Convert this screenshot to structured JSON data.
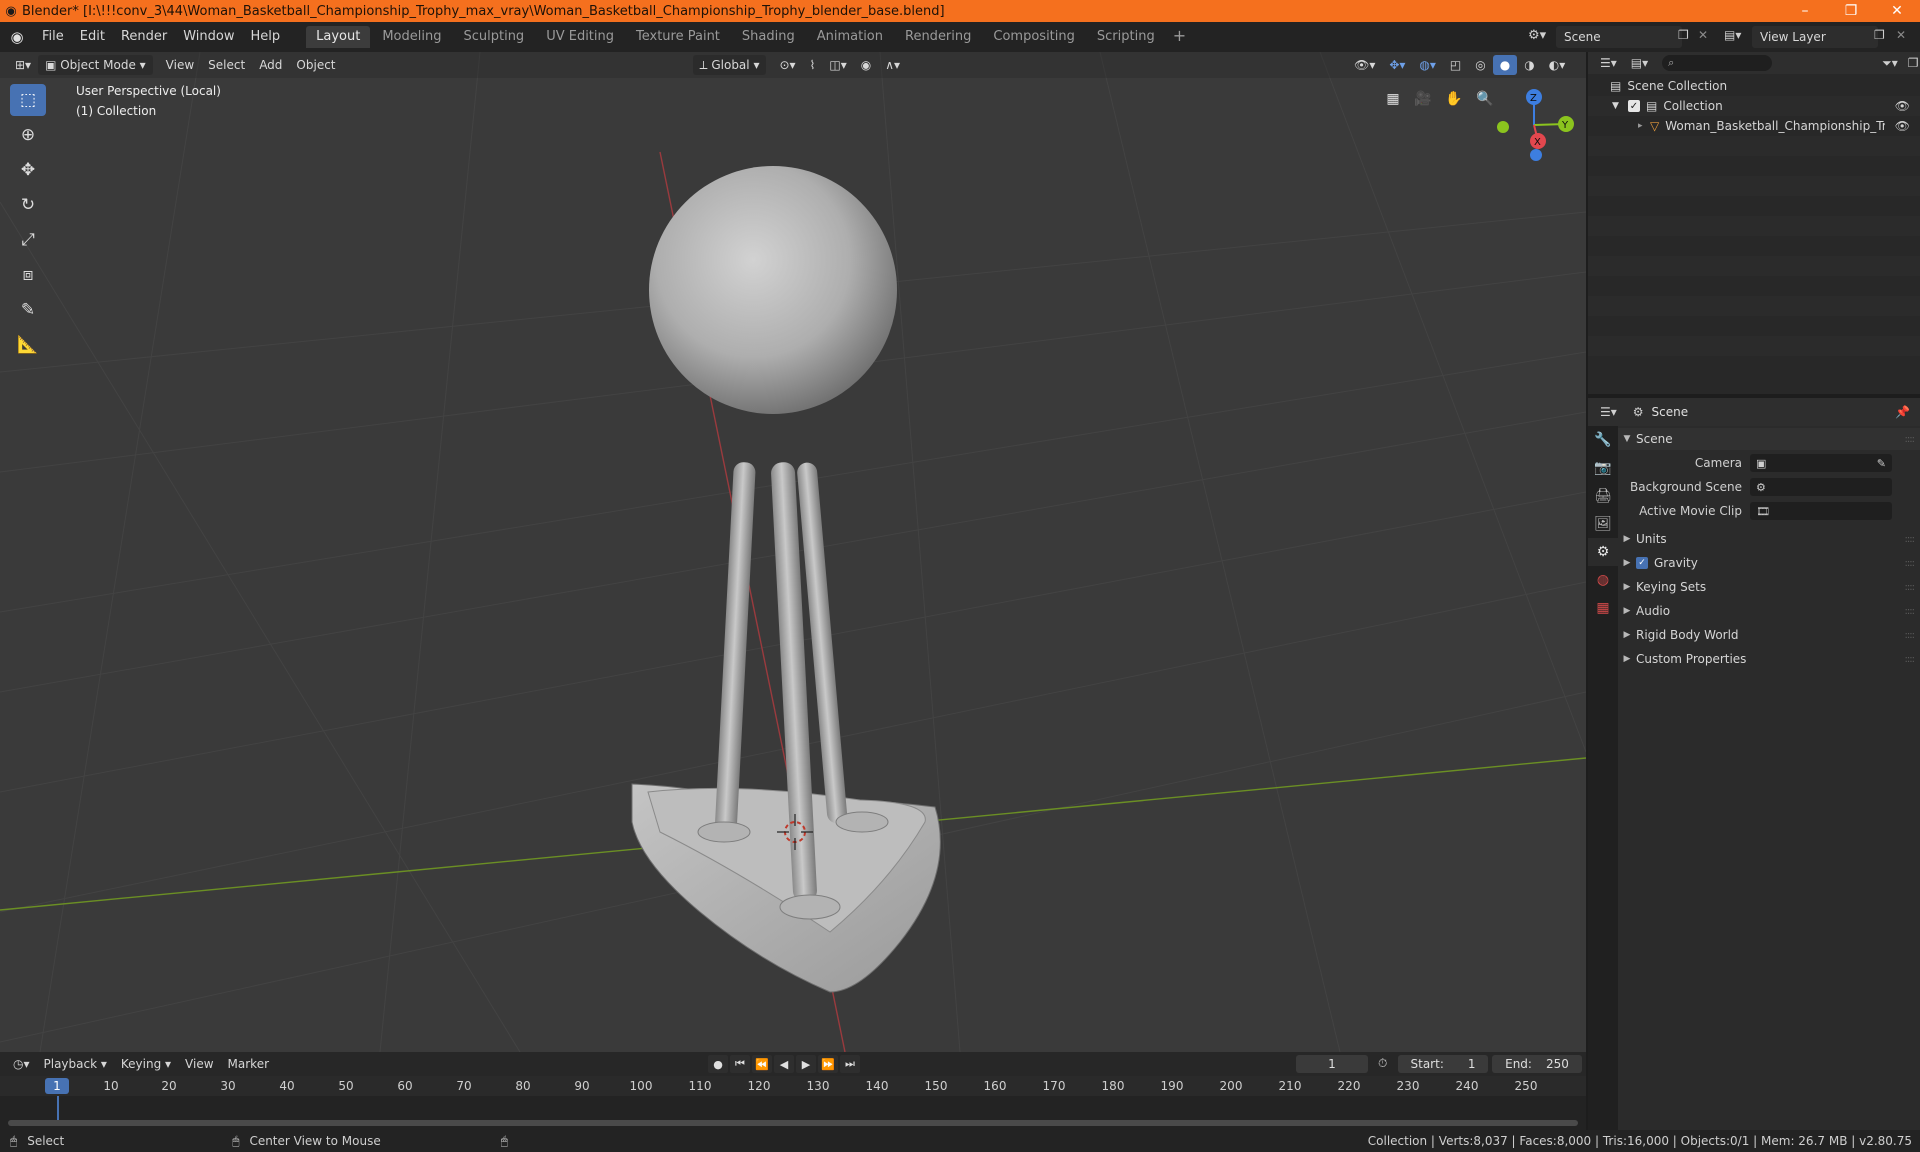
{
  "window": {
    "title": "Blender* [I:\\!!!conv_3\\44\\Woman_Basketball_Championship_Trophy_max_vray\\Woman_Basketball_Championship_Trophy_blender_base.blend]",
    "minimize": "–",
    "maximize": "❐",
    "close": "✕"
  },
  "menu": {
    "items": [
      "File",
      "Edit",
      "Render",
      "Window",
      "Help"
    ]
  },
  "workspaces": {
    "tabs": [
      "Layout",
      "Modeling",
      "Sculpting",
      "UV Editing",
      "Texture Paint",
      "Shading",
      "Animation",
      "Rendering",
      "Compositing",
      "Scripting"
    ],
    "active": "Layout",
    "add": "+"
  },
  "scene_selector": {
    "scene": "Scene",
    "view_layer": "View Layer"
  },
  "viewport": {
    "mode": "Object Mode",
    "menus": [
      "View",
      "Select",
      "Add",
      "Object"
    ],
    "transform_orientation": "Global",
    "info_line1": "User Perspective (Local)",
    "info_line2": "(1) Collection",
    "gizmo": {
      "z": "Z",
      "y": "Y",
      "x": "X"
    }
  },
  "outliner": {
    "search_placeholder": "",
    "scene_collection": "Scene Collection",
    "collection": "Collection",
    "object": "Woman_Basketball_Championship_Trophy_p"
  },
  "properties": {
    "context": "Scene",
    "panels": {
      "scene": "Scene",
      "camera_label": "Camera",
      "background_scene_label": "Background Scene",
      "active_movie_clip_label": "Active Movie Clip",
      "units": "Units",
      "gravity": "Gravity",
      "keying_sets": "Keying Sets",
      "audio": "Audio",
      "rigid_body_world": "Rigid Body World",
      "custom_properties": "Custom Properties"
    }
  },
  "timeline": {
    "menus": [
      "Playback",
      "Keying",
      "View",
      "Marker"
    ],
    "current_frame": "1",
    "start_label": "Start:",
    "start": "1",
    "end_label": "End:",
    "end": "250",
    "ticks": [
      "1",
      "10",
      "20",
      "30",
      "40",
      "50",
      "60",
      "70",
      "80",
      "90",
      "100",
      "110",
      "120",
      "130",
      "140",
      "150",
      "160",
      "170",
      "180",
      "190",
      "200",
      "210",
      "220",
      "230",
      "240",
      "250"
    ]
  },
  "statusbar": {
    "select": "Select",
    "center_view": "Center View to Mouse",
    "stats": "Collection | Verts:8,037 | Faces:8,000 | Tris:16,000 | Objects:0/1 | Mem: 26.7 MB | v2.80.75"
  },
  "colors": {
    "accent": "#4772b3",
    "titlebar": "#f5701e",
    "x_axis": "#e2474e",
    "y_axis": "#8bc41e",
    "z_axis": "#3d7ee0"
  }
}
